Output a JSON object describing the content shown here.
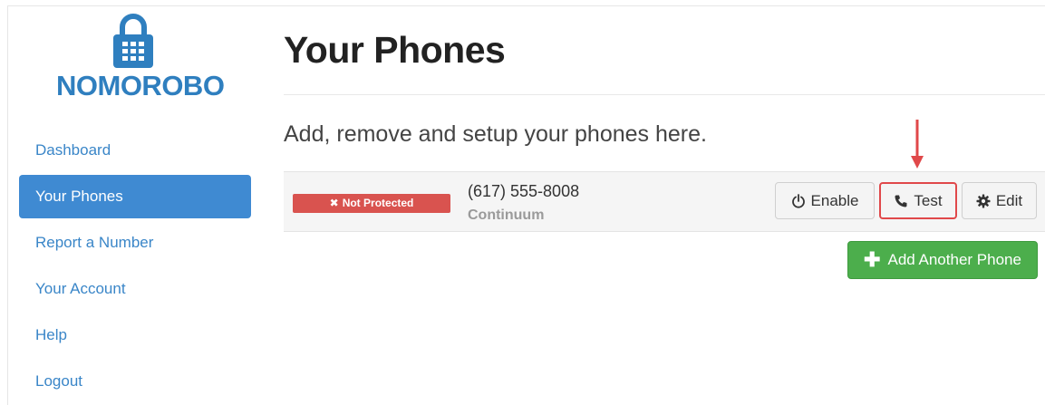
{
  "brand": {
    "name": "NOMOROBO",
    "color": "#2f7fbf"
  },
  "sidebar": {
    "items": [
      {
        "label": "Dashboard",
        "active": false
      },
      {
        "label": "Your Phones",
        "active": true
      },
      {
        "label": "Report a Number",
        "active": false
      },
      {
        "label": "Your Account",
        "active": false
      },
      {
        "label": "Help",
        "active": false
      },
      {
        "label": "Logout",
        "active": false
      }
    ]
  },
  "main": {
    "title": "Your Phones",
    "subtitle": "Add, remove and setup your phones here.",
    "phones": [
      {
        "status": "Not Protected",
        "status_color": "#d9534f",
        "number": "(617) 555-8008",
        "carrier": "Continuum",
        "buttons": {
          "enable": "Enable",
          "test": "Test",
          "edit": "Edit"
        }
      }
    ],
    "add_button": "Add Another Phone"
  },
  "colors": {
    "accent": "#3f8ad2",
    "danger": "#d9534f",
    "success": "#4cae4c",
    "highlight": "#e0484a"
  },
  "icons": [
    "lock-logo-icon",
    "close-icon",
    "power-icon",
    "phone-icon",
    "gear-icon",
    "plus-icon",
    "down-arrow-icon"
  ]
}
